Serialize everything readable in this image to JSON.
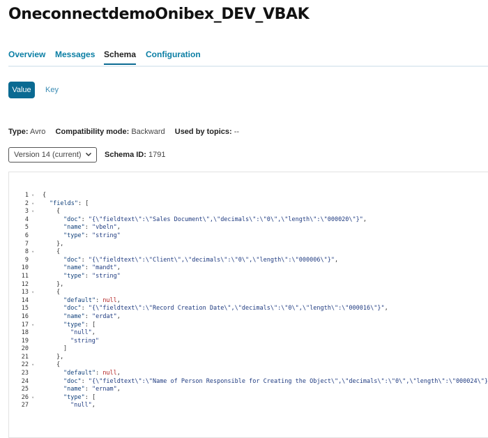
{
  "page": {
    "title": "OneconnectdemoOnibex_DEV_VBAK"
  },
  "tabs": [
    {
      "label": "Overview",
      "active": false
    },
    {
      "label": "Messages",
      "active": false
    },
    {
      "label": "Schema",
      "active": true
    },
    {
      "label": "Configuration",
      "active": false
    }
  ],
  "toggle": {
    "value_label": "Value",
    "key_label": "Key",
    "selected": "Value"
  },
  "meta": {
    "type_label": "Type:",
    "type_value": "Avro",
    "compat_label": "Compatibility mode:",
    "compat_value": "Backward",
    "used_label": "Used by topics:",
    "used_value": "--"
  },
  "version": {
    "selected": "Version 14 (current)",
    "schema_id_label": "Schema ID:",
    "schema_id_value": "1791"
  },
  "colors": {
    "accent": "#0a6a92",
    "tab_link": "#0a7ea4",
    "json_key": "#0f3f7a",
    "json_null": "#b22222"
  },
  "code": {
    "lines": [
      {
        "n": "1",
        "fold": true,
        "indent": 0,
        "parts": [
          [
            "p",
            "{"
          ]
        ]
      },
      {
        "n": "2",
        "fold": true,
        "indent": 1,
        "parts": [
          [
            "k",
            "\"fields\""
          ],
          [
            "p",
            ": ["
          ]
        ]
      },
      {
        "n": "3",
        "fold": true,
        "indent": 2,
        "parts": [
          [
            "p",
            "{"
          ]
        ]
      },
      {
        "n": "4",
        "fold": false,
        "indent": 3,
        "parts": [
          [
            "k",
            "\"doc\""
          ],
          [
            "p",
            ": "
          ],
          [
            "s",
            "\"{\\\"fieldtext\\\":\\\"Sales Document\\\",\\\"decimals\\\":\\\"0\\\",\\\"length\\\":\\\"000020\\\"}\""
          ],
          [
            "p",
            ","
          ]
        ]
      },
      {
        "n": "5",
        "fold": false,
        "indent": 3,
        "parts": [
          [
            "k",
            "\"name\""
          ],
          [
            "p",
            ": "
          ],
          [
            "s",
            "\"vbeln\""
          ],
          [
            "p",
            ","
          ]
        ]
      },
      {
        "n": "6",
        "fold": false,
        "indent": 3,
        "parts": [
          [
            "k",
            "\"type\""
          ],
          [
            "p",
            ": "
          ],
          [
            "s",
            "\"string\""
          ]
        ]
      },
      {
        "n": "7",
        "fold": false,
        "indent": 2,
        "parts": [
          [
            "p",
            "},"
          ]
        ]
      },
      {
        "n": "8",
        "fold": true,
        "indent": 2,
        "parts": [
          [
            "p",
            "{"
          ]
        ]
      },
      {
        "n": "9",
        "fold": false,
        "indent": 3,
        "parts": [
          [
            "k",
            "\"doc\""
          ],
          [
            "p",
            ": "
          ],
          [
            "s",
            "\"{\\\"fieldtext\\\":\\\"Client\\\",\\\"decimals\\\":\\\"0\\\",\\\"length\\\":\\\"000006\\\"}\""
          ],
          [
            "p",
            ","
          ]
        ]
      },
      {
        "n": "10",
        "fold": false,
        "indent": 3,
        "parts": [
          [
            "k",
            "\"name\""
          ],
          [
            "p",
            ": "
          ],
          [
            "s",
            "\"mandt\""
          ],
          [
            "p",
            ","
          ]
        ]
      },
      {
        "n": "11",
        "fold": false,
        "indent": 3,
        "parts": [
          [
            "k",
            "\"type\""
          ],
          [
            "p",
            ": "
          ],
          [
            "s",
            "\"string\""
          ]
        ]
      },
      {
        "n": "12",
        "fold": false,
        "indent": 2,
        "parts": [
          [
            "p",
            "},"
          ]
        ]
      },
      {
        "n": "13",
        "fold": true,
        "indent": 2,
        "parts": [
          [
            "p",
            "{"
          ]
        ]
      },
      {
        "n": "14",
        "fold": false,
        "indent": 3,
        "parts": [
          [
            "k",
            "\"default\""
          ],
          [
            "p",
            ": "
          ],
          [
            "n",
            "null"
          ],
          [
            "p",
            ","
          ]
        ]
      },
      {
        "n": "15",
        "fold": false,
        "indent": 3,
        "parts": [
          [
            "k",
            "\"doc\""
          ],
          [
            "p",
            ": "
          ],
          [
            "s",
            "\"{\\\"fieldtext\\\":\\\"Record Creation Date\\\",\\\"decimals\\\":\\\"0\\\",\\\"length\\\":\\\"000016\\\"}\""
          ],
          [
            "p",
            ","
          ]
        ]
      },
      {
        "n": "16",
        "fold": false,
        "indent": 3,
        "parts": [
          [
            "k",
            "\"name\""
          ],
          [
            "p",
            ": "
          ],
          [
            "s",
            "\"erdat\""
          ],
          [
            "p",
            ","
          ]
        ]
      },
      {
        "n": "17",
        "fold": true,
        "indent": 3,
        "parts": [
          [
            "k",
            "\"type\""
          ],
          [
            "p",
            ": ["
          ]
        ]
      },
      {
        "n": "18",
        "fold": false,
        "indent": 4,
        "parts": [
          [
            "s",
            "\"null\""
          ],
          [
            "p",
            ","
          ]
        ]
      },
      {
        "n": "19",
        "fold": false,
        "indent": 4,
        "parts": [
          [
            "s",
            "\"string\""
          ]
        ]
      },
      {
        "n": "20",
        "fold": false,
        "indent": 3,
        "parts": [
          [
            "p",
            "]"
          ]
        ]
      },
      {
        "n": "21",
        "fold": false,
        "indent": 2,
        "parts": [
          [
            "p",
            "},"
          ]
        ]
      },
      {
        "n": "22",
        "fold": true,
        "indent": 2,
        "parts": [
          [
            "p",
            "{"
          ]
        ]
      },
      {
        "n": "23",
        "fold": false,
        "indent": 3,
        "parts": [
          [
            "k",
            "\"default\""
          ],
          [
            "p",
            ": "
          ],
          [
            "n",
            "null"
          ],
          [
            "p",
            ","
          ]
        ]
      },
      {
        "n": "24",
        "fold": false,
        "indent": 3,
        "parts": [
          [
            "k",
            "\"doc\""
          ],
          [
            "p",
            ": "
          ],
          [
            "s",
            "\"{\\\"fieldtext\\\":\\\"Name of Person Responsible for Creating the Object\\\",\\\"decimals\\\":\\\"0\\\",\\\"length\\\":\\\"000024\\\"}\""
          ],
          [
            "p",
            ","
          ]
        ]
      },
      {
        "n": "25",
        "fold": false,
        "indent": 3,
        "parts": [
          [
            "k",
            "\"name\""
          ],
          [
            "p",
            ": "
          ],
          [
            "s",
            "\"ernam\""
          ],
          [
            "p",
            ","
          ]
        ]
      },
      {
        "n": "26",
        "fold": true,
        "indent": 3,
        "parts": [
          [
            "k",
            "\"type\""
          ],
          [
            "p",
            ": ["
          ]
        ]
      },
      {
        "n": "27",
        "fold": false,
        "indent": 4,
        "parts": [
          [
            "s",
            "\"null\""
          ],
          [
            "p",
            ","
          ]
        ]
      }
    ]
  }
}
